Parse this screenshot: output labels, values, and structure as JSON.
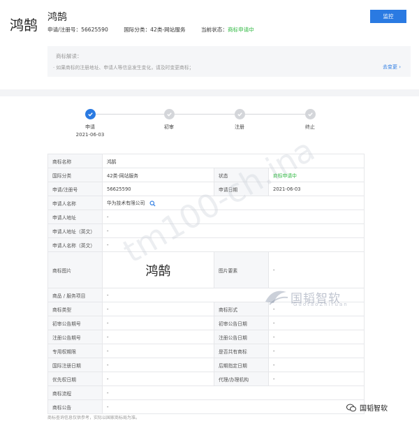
{
  "header": {
    "logo_text": "鸿鹄",
    "brand_title": "鸿鹄",
    "reg_no_label": "申请/注册号：",
    "reg_no": "56625590",
    "class_label": "国际分类：",
    "class_value": "42类-网站服务",
    "status_label": "当前状态：",
    "status_value": "商标申请中",
    "monitor_button": "监控"
  },
  "notice": {
    "title": "商标解读：",
    "text": "· 如果商标的注册地址、申请人等信息发生变化，请及时变更商标；",
    "link": "去变更 ›"
  },
  "steps": [
    {
      "label": "申请",
      "date": "2021-06-03",
      "active": true
    },
    {
      "label": "初审",
      "date": "",
      "active": false
    },
    {
      "label": "注册",
      "date": "",
      "active": false
    },
    {
      "label": "终止",
      "date": "",
      "active": false
    }
  ],
  "table": {
    "name_label": "商标名称",
    "name_value": "鸿鹄",
    "class_label": "国际分类",
    "class_value": "42类-网站服务",
    "status_label": "状态",
    "status_value": "商标申请中",
    "regno_label": "申请/注册号",
    "regno_value": "56625590",
    "appdate_label": "申请日期",
    "appdate_value": "2021-06-03",
    "applicant_label": "申请人名称",
    "applicant_value": "华为技术有限公司",
    "addr_label": "申请人地址",
    "addr_value": "-",
    "addr_en_label": "申请人地址（英文）",
    "addr_en_value": "-",
    "name_en_label": "申请人名称（英文）",
    "name_en_value": "-",
    "image_label": "商标图片",
    "image_text": "鸿鹄",
    "element_label": "图片要素",
    "element_value": "-",
    "goods_label": "商品 / 服务项目",
    "goods_value": "-",
    "type_label": "商标类型",
    "type_value": "-",
    "form_label": "商标形式",
    "form_value": "-",
    "prelim_no_label": "初审公告期号",
    "prelim_no_value": "-",
    "prelim_date_label": "初审公告日期",
    "prelim_date_value": "-",
    "reg_no_label": "注册公告期号",
    "reg_no_value": "-",
    "reg_date_label": "注册公告日期",
    "reg_date_value": "-",
    "term_label": "专用权期限",
    "term_value": "-",
    "shared_label": "是否共有商标",
    "shared_value": "-",
    "intl_date_label": "国际注册日期",
    "intl_date_value": "-",
    "later_date_label": "后期指定日期",
    "later_date_value": "-",
    "priority_label": "优先权日期",
    "priority_value": "-",
    "agent_label": "代理/办理机构",
    "agent_value": "-",
    "flow_label": "商标流程",
    "flow_value": "-",
    "announce_label": "商标公告",
    "announce_value": "-"
  },
  "footnote": "商标查询信息仅供参考，实际以国家商标局为准。",
  "watermark": "tm100-ch.ina",
  "watermark_logo": {
    "cn": "国韬智软",
    "en": "GuotaoZhiruan"
  },
  "wechat_label": "国韬智软",
  "colors": {
    "accent": "#2a7ae2",
    "status_green": "#2eb840"
  }
}
